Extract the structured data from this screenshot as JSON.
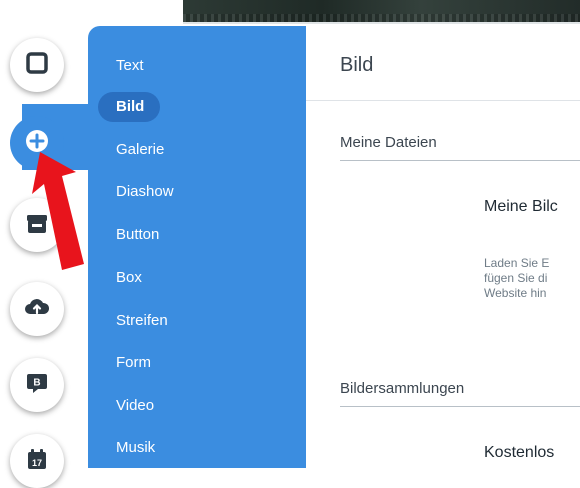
{
  "colors": {
    "accent": "#3b8de0",
    "accent_selected": "#2a6fc0",
    "arrow": "#e8141c"
  },
  "sidebar": {
    "buttons": [
      {
        "icon": "square-icon"
      },
      {
        "icon": "plus-circle-icon",
        "active": true
      },
      {
        "icon": "store-icon"
      },
      {
        "icon": "cloud-upload-icon"
      },
      {
        "icon": "blog-icon",
        "badge": "B"
      },
      {
        "icon": "calendar-icon",
        "badge": "17"
      }
    ]
  },
  "menu": {
    "items": [
      "Text",
      "Bild",
      "Galerie",
      "Diashow",
      "Button",
      "Box",
      "Streifen",
      "Form",
      "Video",
      "Musik"
    ],
    "selected_index": 1
  },
  "content": {
    "title": "Bild",
    "sections": {
      "my_files": "Meine Dateien",
      "collections": "Bildersammlungen"
    },
    "my_images_card": {
      "title": "Meine Bilc",
      "desc_lines": [
        "Laden Sie E",
        "fügen Sie di",
        "Website hin"
      ]
    },
    "free_card": {
      "title": "Kostenlos"
    }
  }
}
